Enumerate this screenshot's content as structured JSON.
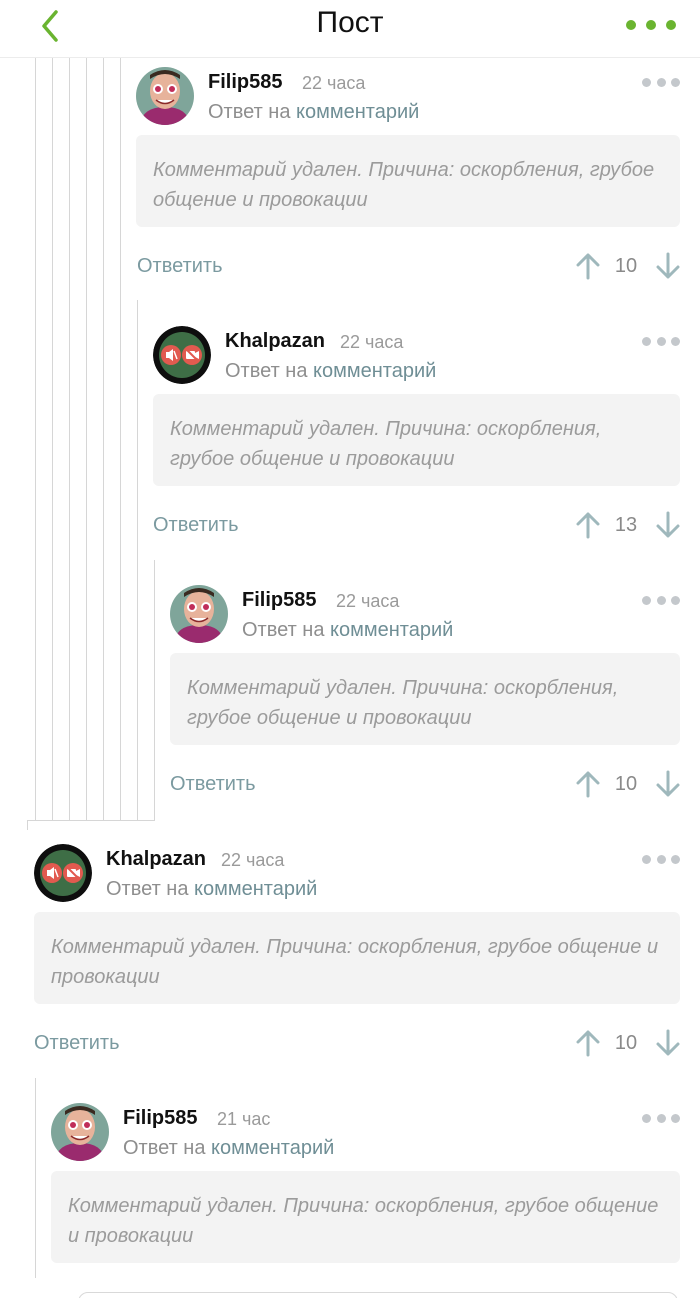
{
  "header": {
    "title": "Пост"
  },
  "colors": {
    "accent": "#6ab430",
    "link": "#6f8e95",
    "muted": "#9a9a9a"
  },
  "comments": [
    {
      "username": "Filip585",
      "time": "22 часа",
      "reply_prefix": "Ответ на",
      "reply_link": "комментарий",
      "body": "Комментарий удален. Причина: оскорбления, грубое общение и провокации",
      "reply_label": "Ответить",
      "rating": "10",
      "avatar": "face-avatar"
    },
    {
      "username": "Khalpazan",
      "time": "22 часа",
      "reply_prefix": "Ответ на",
      "reply_link": "комментарий",
      "body": "Комментарий удален. Причина: оскорбления, грубое общение и провокации",
      "reply_label": "Ответить",
      "rating": "13",
      "avatar": "muted-camera-avatar"
    },
    {
      "username": "Filip585",
      "time": "22 часа",
      "reply_prefix": "Ответ на",
      "reply_link": "комментарий",
      "body": "Комментарий удален. Причина: оскорбления, грубое общение и провокации",
      "reply_label": "Ответить",
      "rating": "10",
      "avatar": "face-avatar"
    },
    {
      "username": "Khalpazan",
      "time": "22 часа",
      "reply_prefix": "Ответ на",
      "reply_link": "комментарий",
      "body": "Комментарий удален. Причина: оскорбления, грубое общение и провокации",
      "reply_label": "Ответить",
      "rating": "10",
      "avatar": "muted-camera-avatar"
    },
    {
      "username": "Filip585",
      "time": "21 час",
      "reply_prefix": "Ответ на",
      "reply_link": "комментарий",
      "body": "Комментарий удален. Причина: оскорбления, грубое общение и провокации",
      "avatar": "face-avatar"
    }
  ]
}
